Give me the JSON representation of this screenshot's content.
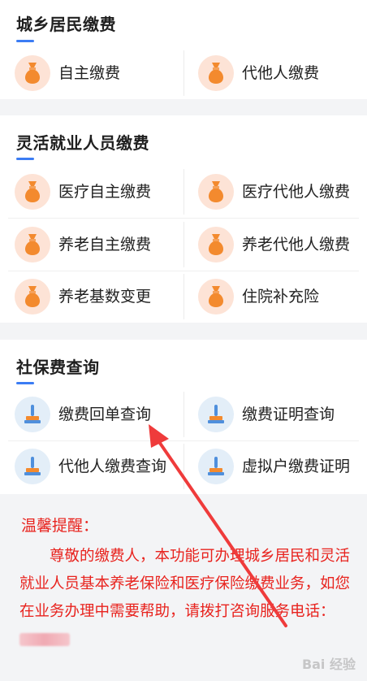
{
  "sections": {
    "urban_rural": {
      "title": "城乡居民缴费",
      "items": [
        "自主缴费",
        "代他人缴费"
      ]
    },
    "flexible": {
      "title": "灵活就业人员缴费",
      "items": [
        "医疗自主缴费",
        "医疗代他人缴费",
        "养老自主缴费",
        "养老代他人缴费",
        "养老基数变更",
        "住院补充险"
      ]
    },
    "query": {
      "title": "社保费查询",
      "items": [
        "缴费回单查询",
        "缴费证明查询",
        "代他人缴费查询",
        "虚拟户缴费证明"
      ]
    }
  },
  "notice": {
    "title": "温馨提醒：",
    "body": "尊敬的缴费人，本功能可办理城乡居民和灵活就业人员基本养老保险和医疗保险缴费业务，如您在业务办理中需要帮助，请拨打咨询服务电话："
  },
  "watermark": "Bai 经验",
  "colors": {
    "accent": "#3b7cf4",
    "notice_red": "#e8231e",
    "pay_icon_bg": "#fde3d6",
    "pay_icon_fg": "#f38a2e",
    "query_icon_bg": "#e3eef8",
    "annotation_arrow": "#ef3b3b"
  },
  "icons": {
    "pay": "money-bag-icon",
    "query": "stamp-icon"
  }
}
